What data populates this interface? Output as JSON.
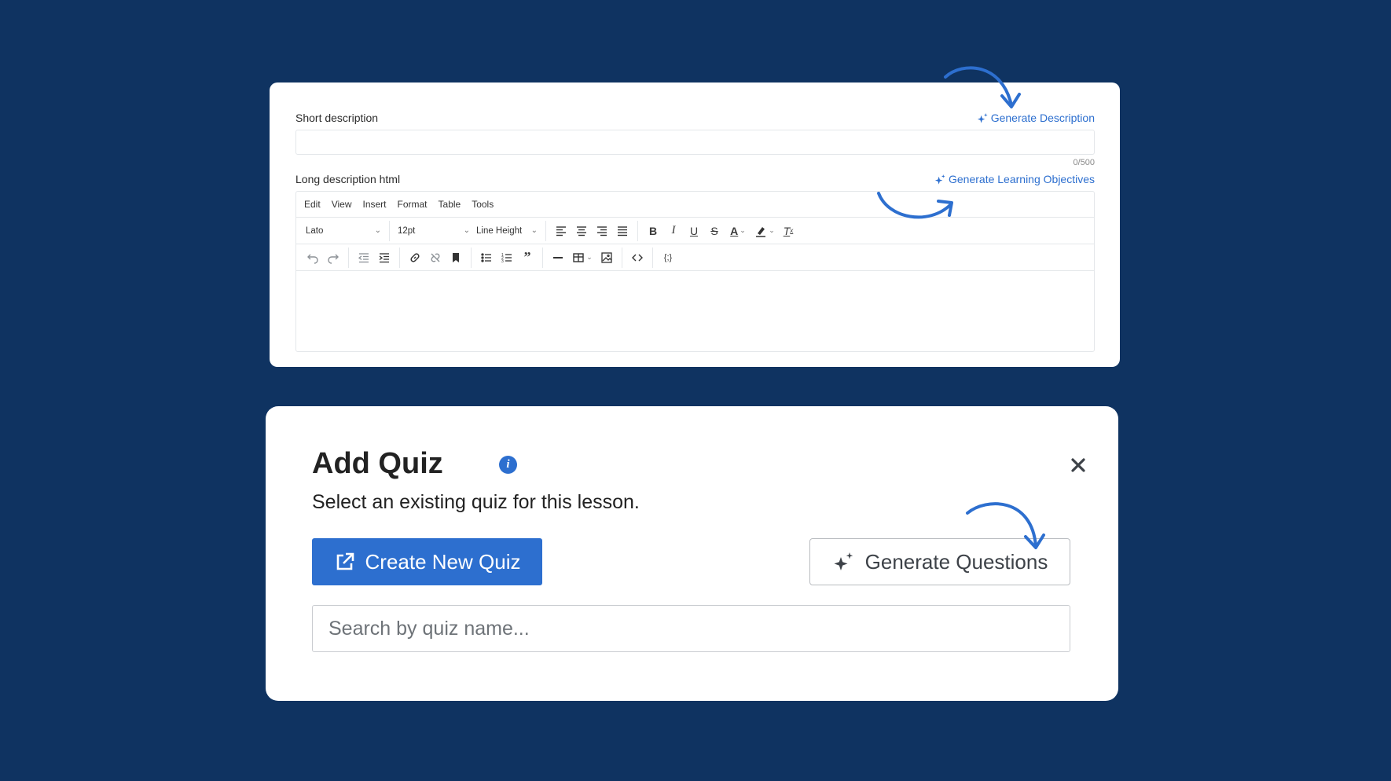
{
  "colors": {
    "background": "#0f3361",
    "accent": "#2d6fcf",
    "arrow": "#2d6fcf"
  },
  "description_panel": {
    "short_description_label": "Short description",
    "generate_description_label": "Generate Description",
    "char_counter": "0/500",
    "long_description_label": "Long description html",
    "generate_objectives_label": "Generate Learning Objectives",
    "menu": [
      "Edit",
      "View",
      "Insert",
      "Format",
      "Table",
      "Tools"
    ],
    "font_family": "Lato",
    "font_size": "12pt",
    "line_height": "Line Height",
    "icons_row1": [
      "align-left-icon",
      "align-center-icon",
      "align-right-icon",
      "align-justify-icon",
      "bold-icon",
      "italic-icon",
      "underline-icon",
      "strikethrough-icon",
      "text-color-icon",
      "highlight-icon",
      "clear-format-icon"
    ],
    "icons_row2": [
      "undo-icon",
      "redo-icon",
      "outdent-icon",
      "indent-icon",
      "link-icon",
      "unlink-icon",
      "bookmark-icon",
      "bullet-list-icon",
      "numbered-list-icon",
      "blockquote-icon",
      "horizontal-rule-icon",
      "table-icon",
      "image-icon",
      "code-icon",
      "template-variable-icon"
    ]
  },
  "quiz_panel": {
    "title": "Add Quiz",
    "subtitle": "Select an existing quiz for this lesson.",
    "create_button": "Create New Quiz",
    "generate_button": "Generate Questions",
    "search_placeholder": "Search by quiz name..."
  }
}
